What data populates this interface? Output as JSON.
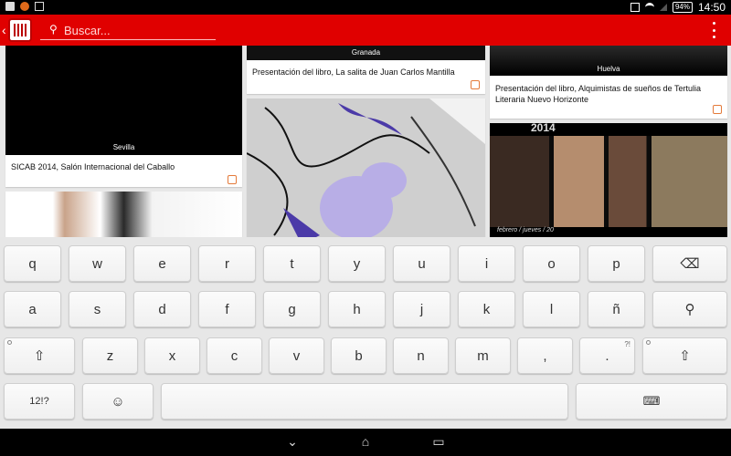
{
  "statusbar": {
    "battery": "94%",
    "time": "14:50"
  },
  "search": {
    "placeholder": "Buscar..."
  },
  "cards": [
    {
      "place": "Sevilla",
      "title": "SICAB 2014, Salón Internacional del Caballo"
    },
    {
      "place": "Granada",
      "title": "Presentación del libro, La salita de Juan Carlos Mantilla"
    },
    {
      "place": "Huelva",
      "title": "Presentación del libro, Alquimistas de sueños de Tertulia Literaria Nuevo Horizonte"
    },
    {
      "poster_year": "2014",
      "poster_footer": "febrero / jueves / 20"
    }
  ],
  "keyboard": {
    "row1": [
      "q",
      "w",
      "e",
      "r",
      "t",
      "y",
      "u",
      "i",
      "o",
      "p"
    ],
    "row2": [
      "a",
      "s",
      "d",
      "f",
      "g",
      "h",
      "j",
      "k",
      "l",
      "ñ"
    ],
    "row3": [
      "z",
      "x",
      "c",
      "v",
      "b",
      "n",
      "m",
      ",",
      "."
    ],
    "row3_hint": "?!",
    "symbols": "12!?"
  },
  "icons": {
    "back": "chevron-left-icon",
    "app": "calendar-icon",
    "search": "search-icon",
    "menu": "overflow-menu-icon",
    "backspace": "backspace-icon",
    "enter": "search-icon",
    "shift": "shift-icon",
    "emoji": "emoji-icon",
    "hide": "keyboard-icon"
  },
  "colors": {
    "accent": "#e00000",
    "category": "#e47a3a"
  }
}
